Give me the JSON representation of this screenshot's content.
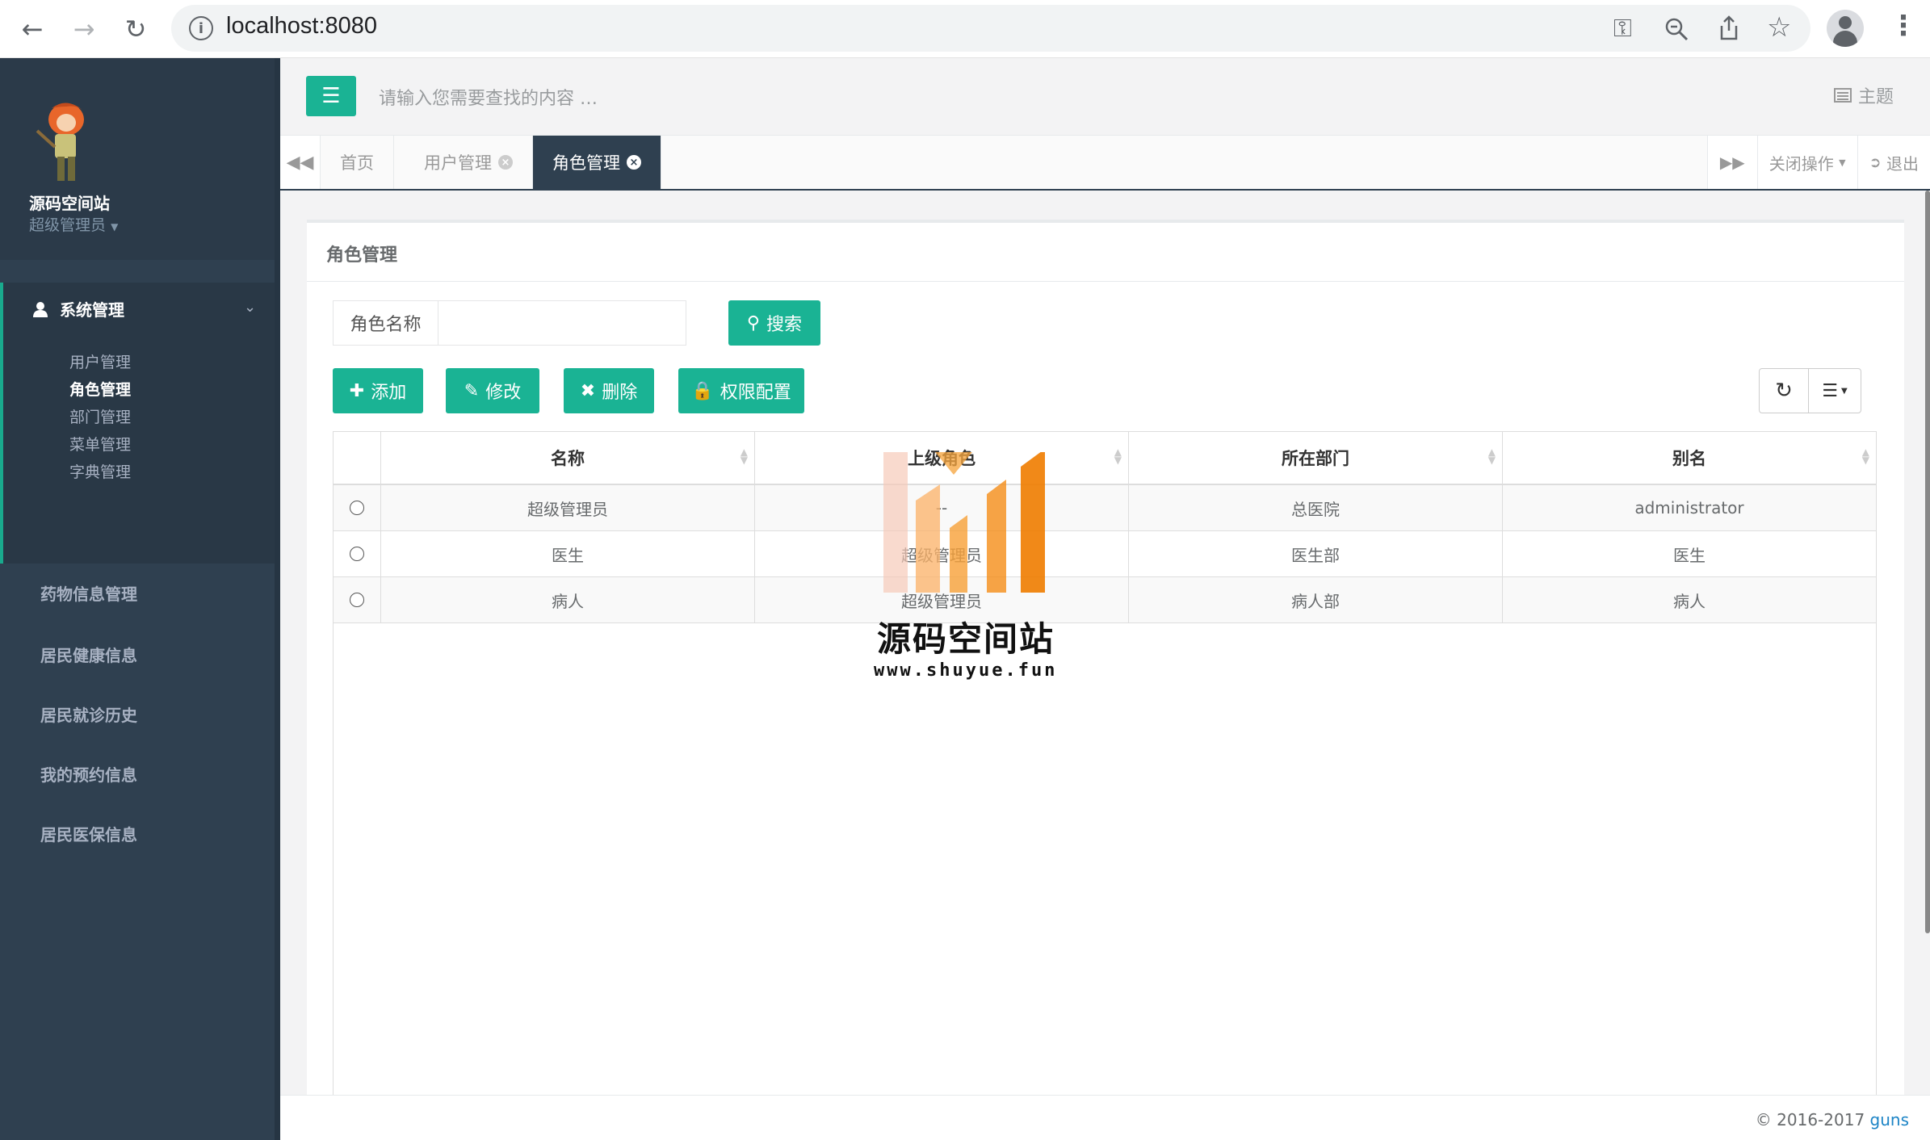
{
  "browser": {
    "url": "localhost:8080",
    "icons": [
      "back-icon",
      "forward-icon",
      "reload-icon",
      "info-icon",
      "key-icon",
      "zoom-icon",
      "share-icon",
      "star-icon",
      "profile-icon",
      "menu-icon"
    ]
  },
  "sidebar": {
    "site_name": "源码空间站",
    "role": "超级管理员",
    "group": {
      "label": "系统管理",
      "items": [
        {
          "label": "用户管理"
        },
        {
          "label": "角色管理"
        },
        {
          "label": "部门管理"
        },
        {
          "label": "菜单管理"
        },
        {
          "label": "字典管理"
        }
      ]
    },
    "items": [
      {
        "label": "药物信息管理"
      },
      {
        "label": "居民健康信息"
      },
      {
        "label": "居民就诊历史"
      },
      {
        "label": "我的预约信息"
      },
      {
        "label": "居民医保信息"
      }
    ]
  },
  "topbar": {
    "search_placeholder": "请输入您需要查找的内容 …",
    "theme_label": "主题"
  },
  "tabs": {
    "items": [
      {
        "label": "首页"
      },
      {
        "label": "用户管理"
      },
      {
        "label": "角色管理"
      }
    ],
    "close_ops": "关闭操作",
    "logout": "退出"
  },
  "panel": {
    "title": "角色管理",
    "search_label": "角色名称",
    "search_value": "",
    "search_button": "搜索",
    "buttons": {
      "add": "添加",
      "edit": "修改",
      "delete": "删除",
      "perm": "权限配置"
    }
  },
  "table": {
    "columns": [
      "名称",
      "上级角色",
      "所在部门",
      "别名"
    ],
    "rows": [
      [
        "超级管理员",
        "--",
        "总医院",
        "administrator"
      ],
      [
        "医生",
        "超级管理员",
        "医生部",
        "医生"
      ],
      [
        "病人",
        "超级管理员",
        "病人部",
        "病人"
      ]
    ]
  },
  "watermark": {
    "name": "源码空间站",
    "url": "www.shuyue.fun"
  },
  "footer": {
    "copyright": "© 2016-2017",
    "link": "guns"
  },
  "colors": {
    "accent": "#1ab394",
    "sidebar": "#2f4050",
    "link": "#1c84c6"
  }
}
